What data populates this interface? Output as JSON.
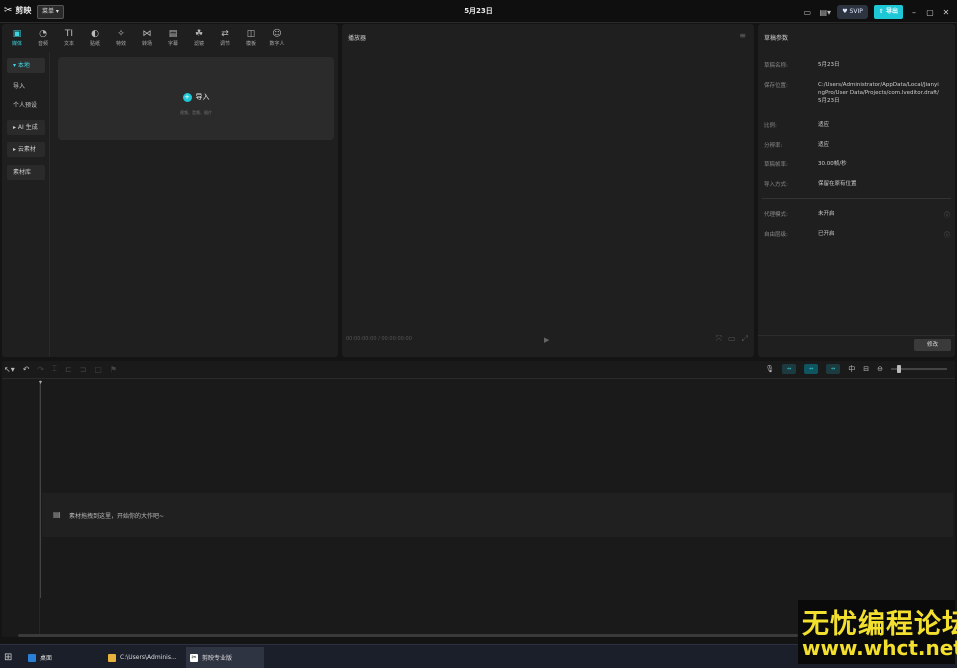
{
  "titlebar": {
    "app_name": "剪映",
    "menu_label": "菜单 ▾",
    "project_title": "5月23日",
    "svip_label": "SVIP",
    "export_label": "导出"
  },
  "media_tabs": [
    {
      "label": "媒体",
      "icon": "media-icon",
      "glyph": "▣"
    },
    {
      "label": "音频",
      "icon": "audio-icon",
      "glyph": "◔"
    },
    {
      "label": "文本",
      "icon": "text-icon",
      "glyph": "TI"
    },
    {
      "label": "贴纸",
      "icon": "sticker-icon",
      "glyph": "◐"
    },
    {
      "label": "特效",
      "icon": "effects-icon",
      "glyph": "✧"
    },
    {
      "label": "转场",
      "icon": "transition-icon",
      "glyph": "⋈"
    },
    {
      "label": "字幕",
      "icon": "subtitle-icon",
      "glyph": "▤"
    },
    {
      "label": "滤镜",
      "icon": "filter-icon",
      "glyph": "☘"
    },
    {
      "label": "调节",
      "icon": "adjust-icon",
      "glyph": "⇄"
    },
    {
      "label": "模板",
      "icon": "template-icon",
      "glyph": "◫"
    },
    {
      "label": "数字人",
      "icon": "digital-human-icon",
      "glyph": "☺"
    }
  ],
  "media_sidebar": {
    "local": "▾ 本地",
    "import": "导入",
    "personal": "个人预设",
    "ai": "▸ AI 生成",
    "cloud": "▸ 云素材",
    "library": "素材库"
  },
  "import_area": {
    "label": "导入",
    "hint": "视频、音频、图片"
  },
  "player": {
    "title": "播放器",
    "timecode": "00:00:00:00 / 00:00:00:00"
  },
  "props": {
    "title": "草稿参数",
    "rows": [
      {
        "key": "草稿名称:",
        "value": "5月23日"
      },
      {
        "key": "保存位置:",
        "value": "C:/Users/Administrator/AppData/Local/JianyingPro/User Data/Projects/com.lveditor.draft/5月23日"
      },
      {
        "key": "比例:",
        "value": "适应"
      },
      {
        "key": "分辨率:",
        "value": "适应"
      },
      {
        "key": "草稿帧率:",
        "value": "30.00帧/秒"
      },
      {
        "key": "导入方式:",
        "value": "保留在原有位置"
      },
      {
        "key": "代理模式:",
        "value": "未开启"
      },
      {
        "key": "自由层级:",
        "value": "已开启"
      }
    ],
    "modify_label": "修改"
  },
  "timeline": {
    "drop_hint": "素材拖拽到这里，开始你的大作吧~"
  },
  "taskbar": {
    "desktop": "桌面",
    "explorer": "C:\\Users\\Adminis...",
    "app": "剪映专业版"
  },
  "watermark": {
    "cn": "无忧编程论坛",
    "url": "www.whct.net"
  },
  "colors": {
    "accent": "#1ec7d6",
    "watermark": "#f3df2e"
  }
}
